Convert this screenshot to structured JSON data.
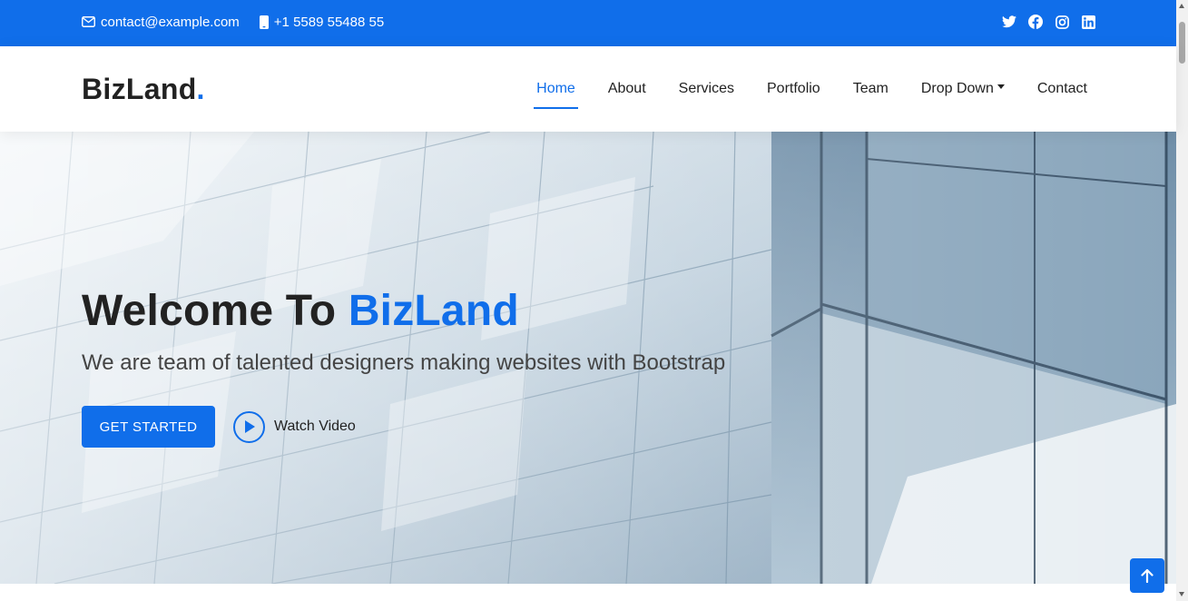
{
  "topbar": {
    "email": "contact@example.com",
    "phone": "+1 5589 55488 55",
    "social": [
      "twitter-icon",
      "facebook-icon",
      "instagram-icon",
      "linkedin-icon"
    ]
  },
  "header": {
    "logo_text": "BizLand",
    "logo_dot": ".",
    "nav": {
      "home": "Home",
      "about": "About",
      "services": "Services",
      "portfolio": "Portfolio",
      "team": "Team",
      "dropdown": "Drop Down",
      "contact": "Contact"
    },
    "active": "Home"
  },
  "hero": {
    "title_prefix": "Welcome To ",
    "title_brand": "BizLand",
    "subtitle": "We are team of talented designers making websites with Bootstrap",
    "cta_label": "GET STARTED",
    "video_label": "Watch Video"
  },
  "colors": {
    "accent": "#106eea",
    "text": "#222222"
  }
}
